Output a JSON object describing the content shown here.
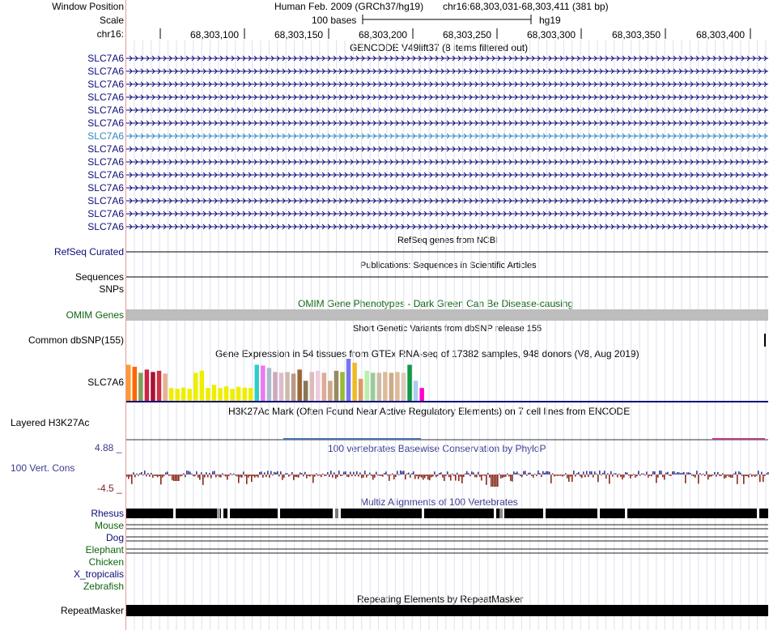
{
  "header": {
    "window_position_label": "Window Position",
    "scale_label": "Scale",
    "chrom_label": "chr16:",
    "assembly": "Human Feb. 2009 (GRCh37/hg19)",
    "position": "chr16:68,303,031-68,303,411 (381 bp)",
    "scale_bar_text": "100 bases",
    "scale_db": "hg19",
    "ruler_ticks": [
      "68,303,100",
      "68,303,150",
      "68,303,200",
      "68,303,250",
      "68,303,300",
      "68,303,350",
      "68,303,400"
    ]
  },
  "gencode": {
    "title": "GENCODE V49lift37 (8 items filtered out)",
    "items": [
      "SLC7A6",
      "SLC7A6",
      "SLC7A6",
      "SLC7A6",
      "SLC7A6",
      "SLC7A6",
      "SLC7A6",
      "SLC7A6",
      "SLC7A6",
      "SLC7A6",
      "SLC7A6",
      "SLC7A6",
      "SLC7A6",
      "SLC7A6"
    ],
    "selected_index": 6,
    "colors": {
      "normal": "#0c0c78",
      "selected": "#2f8ac2"
    }
  },
  "refseq": {
    "title": "RefSeq genes from NCBI",
    "label": "RefSeq Curated"
  },
  "publications": {
    "title": "Publications: Sequences in Scientific Articles",
    "label": "Sequences"
  },
  "snps_label": "SNPs",
  "omim": {
    "title": "OMIM Gene Phenotypes - Dark Green Can Be Disease-causing",
    "label": "OMIM Genes",
    "color": "#0d640d"
  },
  "dbsnp": {
    "title": "Short Genetic Variants from dbSNP release 155",
    "label": "Common dbSNP(155)"
  },
  "gtex": {
    "title": "Gene Expression in 54 tissues from GTEx RNA-seq of 17382 samples, 948 donors (V8, Aug 2019)",
    "label": "SLC7A6",
    "baseline_color": "#0c0c78",
    "bars": [
      {
        "h": 0.9,
        "c": "#ff9933"
      },
      {
        "h": 0.85,
        "c": "#ff6600"
      },
      {
        "h": 0.7,
        "c": "#7fa05e"
      },
      {
        "h": 0.78,
        "c": "#cc2244"
      },
      {
        "h": 0.72,
        "c": "#aa1133"
      },
      {
        "h": 0.75,
        "c": "#cc3344"
      },
      {
        "h": 0.68,
        "c": "#e8b094"
      },
      {
        "h": 0.32,
        "c": "#eeee00"
      },
      {
        "h": 0.3,
        "c": "#eeee00"
      },
      {
        "h": 0.33,
        "c": "#eeee00"
      },
      {
        "h": 0.3,
        "c": "#eeee00"
      },
      {
        "h": 0.7,
        "c": "#eeee00"
      },
      {
        "h": 0.75,
        "c": "#eeee00"
      },
      {
        "h": 0.32,
        "c": "#eeee00"
      },
      {
        "h": 0.4,
        "c": "#eeee00"
      },
      {
        "h": 0.32,
        "c": "#eeee00"
      },
      {
        "h": 0.36,
        "c": "#eeee00"
      },
      {
        "h": 0.3,
        "c": "#eeee00"
      },
      {
        "h": 0.35,
        "c": "#eeee00"
      },
      {
        "h": 0.33,
        "c": "#eeee00"
      },
      {
        "h": 0.32,
        "c": "#eeee00"
      },
      {
        "h": 0.9,
        "c": "#33cccc"
      },
      {
        "h": 0.88,
        "c": "#ee77ee"
      },
      {
        "h": 0.82,
        "c": "#aabbcc"
      },
      {
        "h": 0.72,
        "c": "#ccaabb"
      },
      {
        "h": 0.7,
        "c": "#ddbbcc"
      },
      {
        "h": 0.72,
        "c": "#ccbbaa"
      },
      {
        "h": 0.68,
        "c": "#bb9988"
      },
      {
        "h": 0.78,
        "c": "#996633"
      },
      {
        "h": 0.5,
        "c": "#887755"
      },
      {
        "h": 0.72,
        "c": "#ddbbbb"
      },
      {
        "h": 0.75,
        "c": "#eeccdd"
      },
      {
        "h": 0.7,
        "c": "#ddaa99"
      },
      {
        "h": 0.5,
        "c": "#ccaa88"
      },
      {
        "h": 0.75,
        "c": "#998866"
      },
      {
        "h": 0.72,
        "c": "#99bb33"
      },
      {
        "h": 1.05,
        "c": "#7777ee"
      },
      {
        "h": 0.95,
        "c": "#eebb22"
      },
      {
        "h": 0.55,
        "c": "#dd9966"
      },
      {
        "h": 0.75,
        "c": "#bbeeaa"
      },
      {
        "h": 0.7,
        "c": "#99cc99"
      },
      {
        "h": 0.7,
        "c": "#ccbbaa"
      },
      {
        "h": 0.72,
        "c": "#ddbb99"
      },
      {
        "h": 0.7,
        "c": "#ccaa88"
      },
      {
        "h": 0.72,
        "c": "#ddbb99"
      },
      {
        "h": 0.7,
        "c": "#ddccbb"
      },
      {
        "h": 0.9,
        "c": "#119944"
      },
      {
        "h": 0.5,
        "c": "#aaccee"
      },
      {
        "h": 0.32,
        "c": "#ff00cc"
      }
    ]
  },
  "h3k27ac": {
    "title": "H3K27Ac Mark (Often Found Near Active Regulatory Elements) on 7 cell lines from ENCODE",
    "label": "Layered H3K27Ac"
  },
  "conservation": {
    "title": "100 vertebrates Basewise Conservation by PhyloP",
    "label": "100 Vert. Cons",
    "max_label": "4.88 _",
    "min_label": "-4.5 _",
    "pos_color": "#3a3a8e",
    "neg_color": "#8a2a1a"
  },
  "multiz": {
    "title": "Multiz Alignments of 100 Vertebrates",
    "species": [
      {
        "name": "Rhesus",
        "color": "#0c0c78"
      },
      {
        "name": "Mouse",
        "color": "#0d640d"
      },
      {
        "name": "Dog",
        "color": "#0c0c78"
      },
      {
        "name": "Elephant",
        "color": "#0d640d"
      },
      {
        "name": "Chicken",
        "color": "#0d640d"
      },
      {
        "name": "X_tropicalis",
        "color": "#0c0c78"
      },
      {
        "name": "Zebrafish",
        "color": "#0d640d"
      }
    ]
  },
  "repeatmasker": {
    "title": "Repeating Elements by RepeatMasker",
    "label": "RepeatMasker"
  }
}
